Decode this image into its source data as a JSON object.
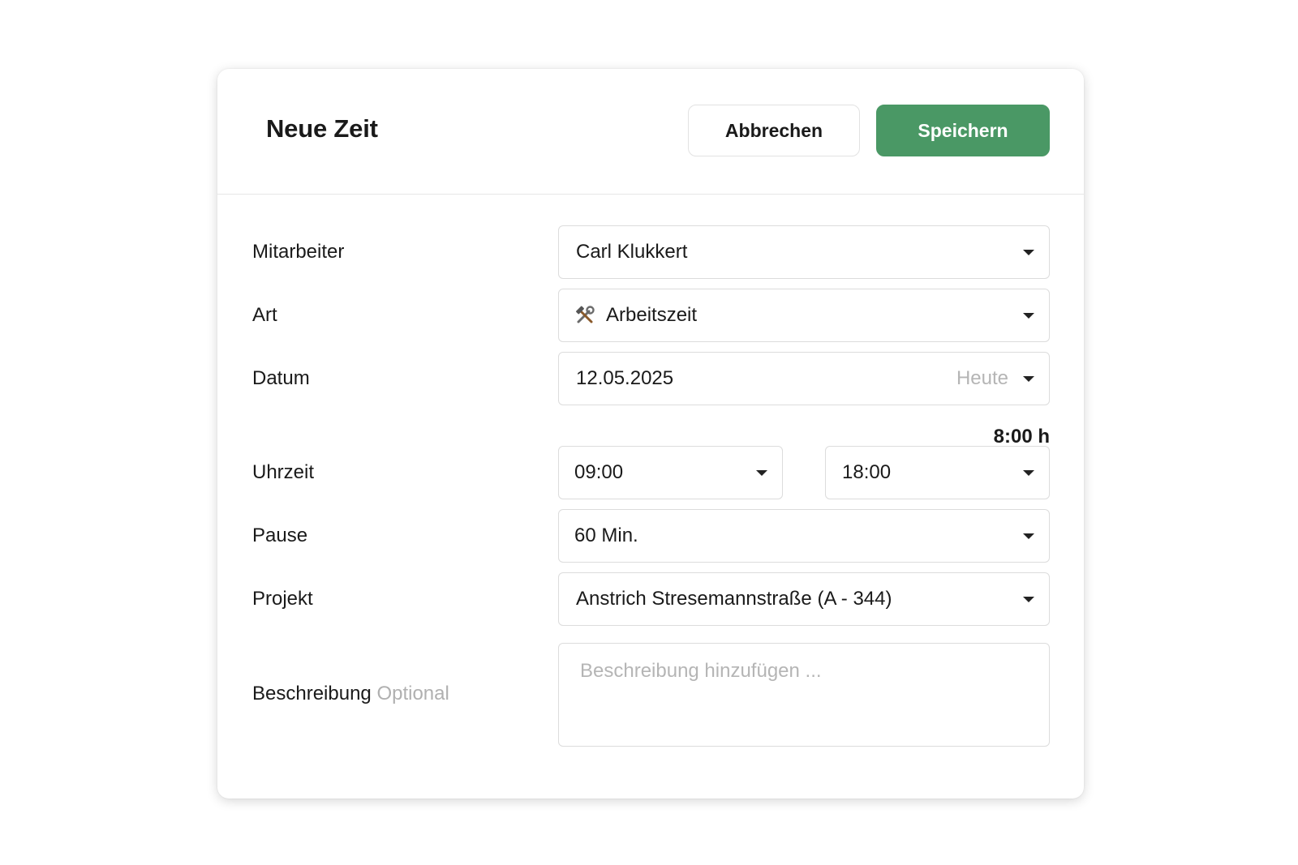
{
  "dialog": {
    "title": "Neue Zeit",
    "cancel_label": "Abbrechen",
    "save_label": "Speichern"
  },
  "colors": {
    "save_button": "#4a9865",
    "muted_text": "#b0b0b0"
  },
  "form": {
    "employee": {
      "label": "Mitarbeiter",
      "value": "Carl Klukkert"
    },
    "type": {
      "label": "Art",
      "value": "Arbeitszeit",
      "icon": "hammer-and-wrench-icon"
    },
    "date": {
      "label": "Datum",
      "value": "12.05.2025",
      "hint": "Heute"
    },
    "duration": "8:00 h",
    "time": {
      "label": "Uhrzeit",
      "start": "09:00",
      "end": "18:00"
    },
    "break": {
      "label": "Pause",
      "value": "60 Min."
    },
    "project": {
      "label": "Projekt",
      "value": "Anstrich Stresemannstraße (A - 344)"
    },
    "description": {
      "label": "Beschreibung",
      "optional": "Optional",
      "placeholder": "Beschreibung hinzufügen ..."
    }
  }
}
